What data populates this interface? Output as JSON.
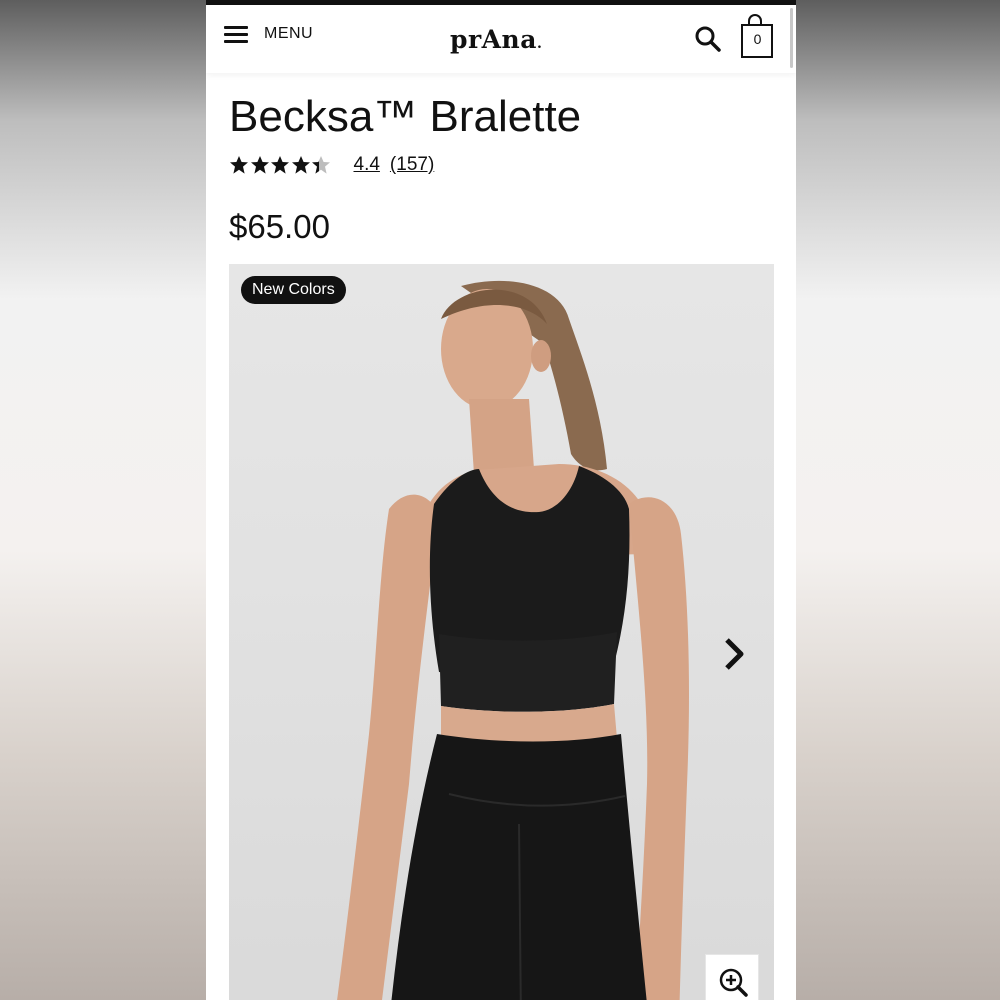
{
  "header": {
    "menu_label": "MENU",
    "logo_text": "prAna",
    "logo_mark": ".",
    "cart_count": "0"
  },
  "product": {
    "title": "Becksa™ Bralette",
    "rating_value": "4.4",
    "review_count": "(157)",
    "rating_fraction": 0.88,
    "price": "$65.00",
    "badge": "New Colors"
  },
  "colors": {
    "text": "#111111",
    "star_filled": "#111111",
    "star_empty": "#bdbdbd",
    "badge_bg": "#111111"
  },
  "icons": [
    "hamburger-icon",
    "search-icon",
    "shopping-bag-icon",
    "star-icon",
    "chevron-right-icon",
    "zoom-in-icon"
  ]
}
